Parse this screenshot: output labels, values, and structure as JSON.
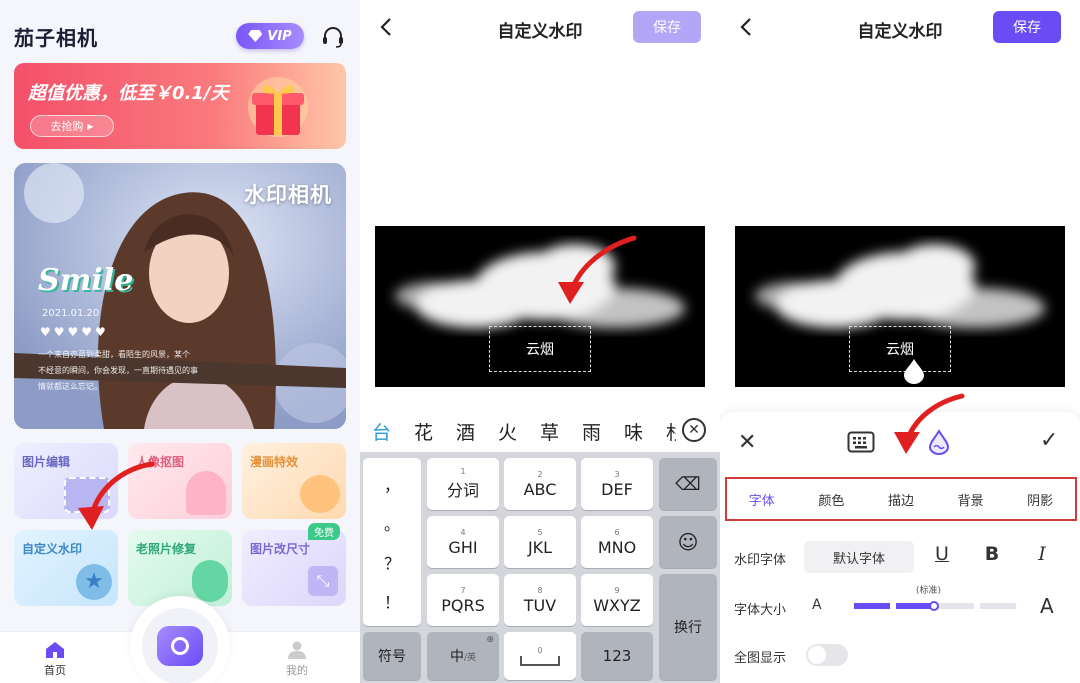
{
  "home": {
    "app_title": "茄子相机",
    "vip_label": "VIP",
    "banner": {
      "text": "超值优惠，低至￥0.1/天",
      "button": "去抢购"
    },
    "hero": {
      "title": "水印相机",
      "smile": "Smile",
      "date": "2021.01.20",
      "hearts": "♥♥♥♥♥",
      "caption": [
        "一个来自亦蓝到柔甜，看陌生的风景，某个",
        "不经意的瞬间，你会发现，一直期待遇见的事",
        "情就都这么忘记。"
      ]
    },
    "cards": [
      "图片编辑",
      "人像抠图",
      "漫画特效",
      "自定义水印",
      "老照片修复",
      "图片改尺寸"
    ],
    "free_badge": "免费",
    "nav": {
      "home": "首页",
      "mine": "我的"
    },
    "colors": {
      "accent": "#6a4cf4",
      "banner": "#f4506a",
      "highlight": "#d33a3a"
    }
  },
  "editor": {
    "title": "自定义水印",
    "save": "保存",
    "watermark_text": "云烟"
  },
  "keyboard": {
    "candidates": [
      "台",
      "花",
      "酒",
      "火",
      "草",
      "雨",
      "味",
      "杉"
    ],
    "left_punct": [
      "，",
      "。",
      "？",
      "！"
    ],
    "keys": [
      {
        "num": "1",
        "label": "分词"
      },
      {
        "num": "2",
        "label": "ABC"
      },
      {
        "num": "3",
        "label": "DEF"
      },
      {
        "num": "4",
        "label": "GHI"
      },
      {
        "num": "5",
        "label": "JKL"
      },
      {
        "num": "6",
        "label": "MNO"
      },
      {
        "num": "7",
        "label": "PQRS"
      },
      {
        "num": "8",
        "label": "TUV"
      },
      {
        "num": "9",
        "label": "WXYZ"
      }
    ],
    "symbols": "符号",
    "zh": "中",
    "zh_sub": "/英",
    "zero": "0",
    "num_key": "123",
    "enter": "换行"
  },
  "style_panel": {
    "tabs": [
      "字体",
      "颜色",
      "描边",
      "背景",
      "阴影"
    ],
    "font_label": "水印字体",
    "font_value": "默认字体",
    "size_label": "字体大小",
    "size_hint": "(标准)",
    "size_level": 0.5,
    "fullscreen_label": "全图显示",
    "fullscreen_on": false
  }
}
